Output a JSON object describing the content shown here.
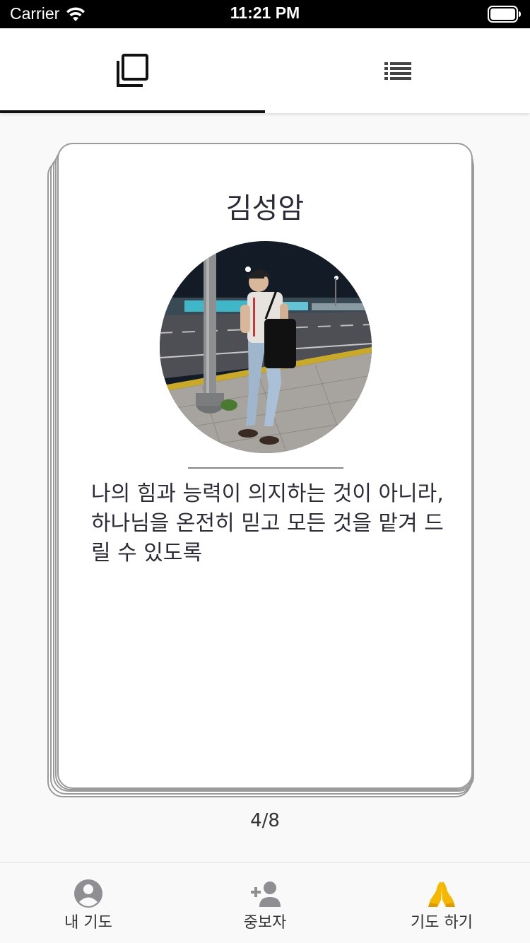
{
  "status_bar": {
    "carrier": "Carrier",
    "time": "11:21 PM"
  },
  "top_tabs": [
    {
      "icon": "card-view-icon",
      "active": true
    },
    {
      "icon": "list-view-icon",
      "active": false
    }
  ],
  "card": {
    "name": "김성암",
    "prayer_text": "나의 힘과 능력이 의지하는 것이 아니라, 하나님을 온전히 믿고 모든 것을 맡겨 드릴 수 있도록"
  },
  "page_indicator": "4/8",
  "bottom_nav": {
    "items": [
      {
        "label": "내 기도",
        "icon": "account-circle-icon"
      },
      {
        "label": "중보자",
        "icon": "person-add-icon"
      },
      {
        "label": "기도 하기",
        "icon": "praying-hands-icon",
        "active": true
      }
    ]
  },
  "colors": {
    "active_nav_icon": "#f5b800",
    "inactive_nav_icon": "#8e8e93",
    "text": "#2b2b38"
  }
}
